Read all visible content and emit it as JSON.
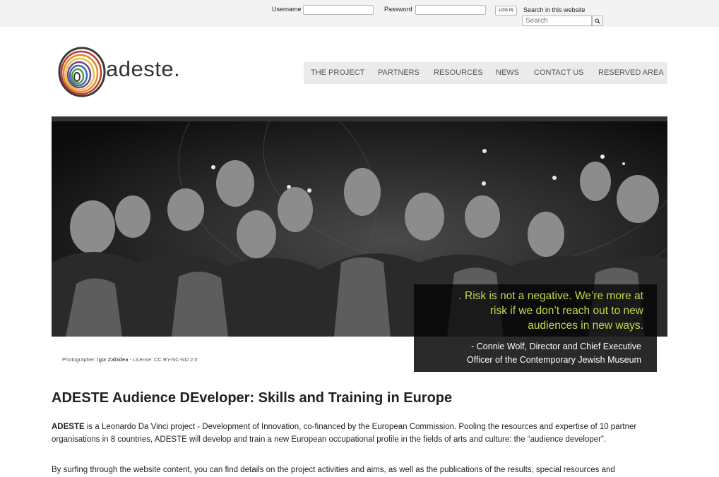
{
  "topbar": {
    "username_label": "Username",
    "password_label": "Password",
    "login_label": "LOG IN",
    "search_title": "Search in this website",
    "search_placeholder": "Search",
    "search_button_icon": "magnifier-icon"
  },
  "header": {
    "logo_text": "adeste.",
    "nav": [
      "THE PROJECT",
      "PARTNERS",
      "RESOURCES",
      "NEWS",
      "CONTACT US",
      "RESERVED AREA"
    ]
  },
  "hero": {
    "quote_lines": [
      ". Risk is not a negative. We’re more at",
      "risk if we don’t reach out to new",
      "audiences in new ways."
    ],
    "author_lines": [
      "- Connie Wolf, Director and Chief Executive",
      "Officer of the Contemporary Jewish Museum"
    ],
    "credit_prefix": "Photographer: ",
    "credit_name": "Igor Zalbidea",
    "credit_suffix": " - License: CC BY-NC-ND 2.0"
  },
  "main": {
    "title": "ADESTE Audience DEveloper: Skills and Training in Europe",
    "intro_bold": "ADESTE",
    "intro_rest": " is a Leonardo Da Vinci project - Development of Innovation, co-financed by the European Commission. Pooling the resources and expertise of 10 partner organisations in 8 countries, ADESTE will develop and train a new European occupational profile in the fields of arts and culture: the “audience developer”.",
    "second_para": "By surfing through the website content, you can find details on the project activities and aims, as well as the publications of the results, special resources and"
  },
  "colors": {
    "quote": "#c5d84a",
    "nav_bg": "#ebebeb",
    "topbar_bg": "#f3f3f3"
  }
}
